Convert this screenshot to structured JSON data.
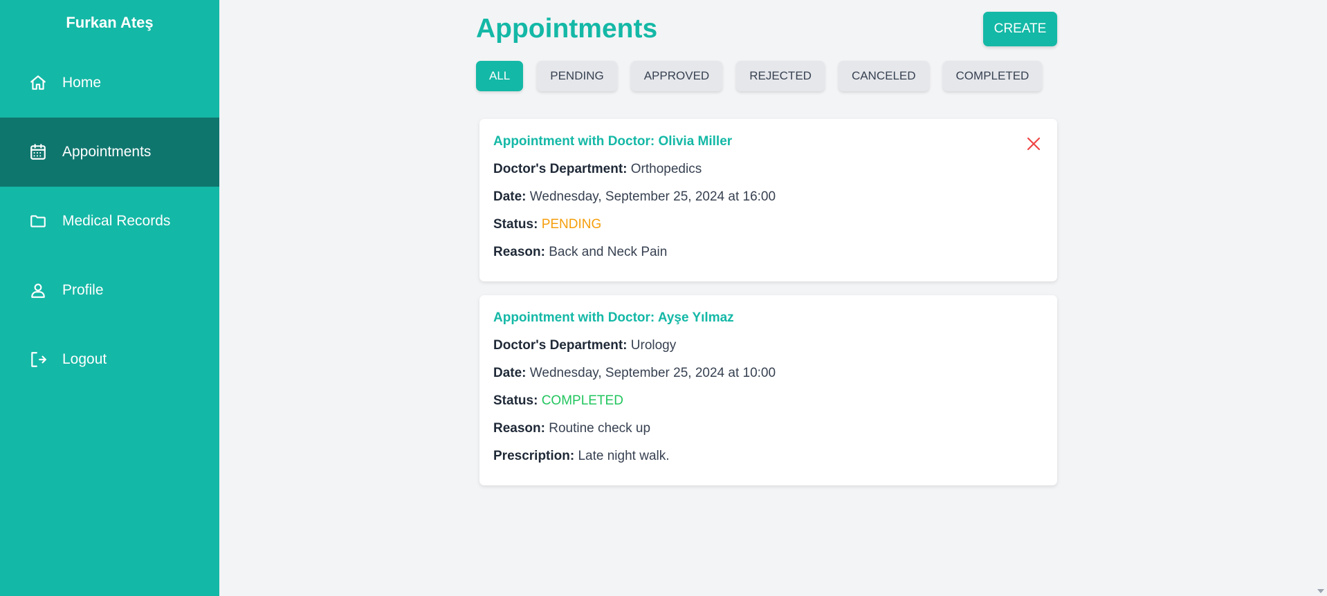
{
  "sidebar": {
    "user_name": "Furkan Ateş",
    "items": [
      {
        "label": "Home",
        "icon": "home-icon"
      },
      {
        "label": "Appointments",
        "icon": "calendar-icon",
        "active": true
      },
      {
        "label": "Medical Records",
        "icon": "folder-icon"
      },
      {
        "label": "Profile",
        "icon": "user-icon"
      },
      {
        "label": "Logout",
        "icon": "logout-icon"
      }
    ]
  },
  "main": {
    "title": "Appointments",
    "create_label": "CREATE",
    "filters": [
      "ALL",
      "PENDING",
      "APPROVED",
      "REJECTED",
      "CANCELED",
      "COMPLETED"
    ],
    "active_filter": "ALL",
    "appointments": [
      {
        "title": "Appointment with Doctor: Olivia Miller",
        "department_label": "Doctor's Department:",
        "department": "Orthopedics",
        "date_label": "Date:",
        "date": "Wednesday, September 25, 2024 at 16:00",
        "status_label": "Status:",
        "status": "PENDING",
        "reason_label": "Reason:",
        "reason": "Back and Neck Pain"
      },
      {
        "title": "Appointment with Doctor: Ayşe Yılmaz",
        "department_label": "Doctor's Department:",
        "department": "Urology",
        "date_label": "Date:",
        "date": "Wednesday, September 25, 2024 at 10:00",
        "status_label": "Status:",
        "status": "COMPLETED",
        "reason_label": "Reason:",
        "reason": "Routine check up",
        "prescription_label": "Prescription:",
        "prescription": "Late night walk."
      }
    ]
  },
  "colors": {
    "accent": "#14b8a6",
    "sidebar_active": "#0f766e",
    "pending": "#f59e0b",
    "completed": "#22c55e",
    "delete": "#ef4444"
  }
}
